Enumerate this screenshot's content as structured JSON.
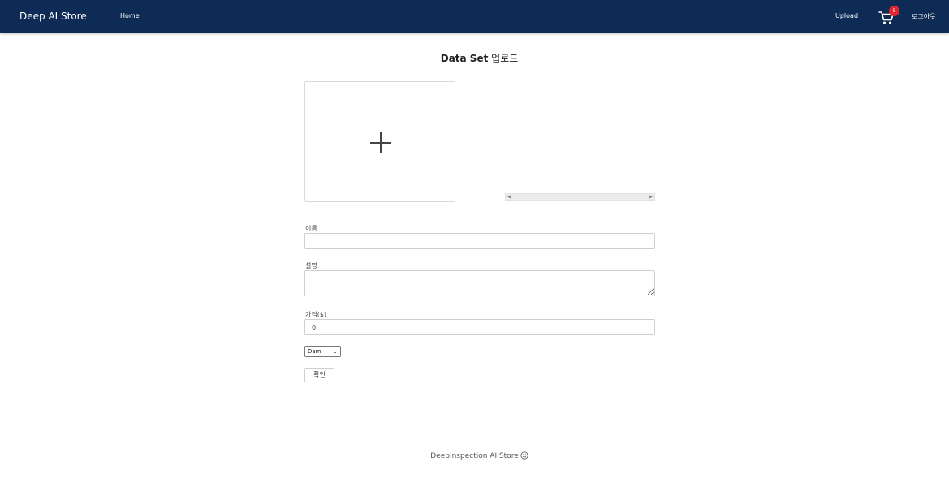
{
  "navbar": {
    "brand": "Deep AI Store",
    "home": "Home",
    "upload": "Upload",
    "cart_count": "5",
    "logout": "로그아웃"
  },
  "page": {
    "title_bold": "Data Set",
    "title_rest": " 업로드"
  },
  "form": {
    "name_label": "이름",
    "name_value": "",
    "desc_label": "설명",
    "desc_value": "",
    "price_label": "가격($)",
    "price_value": "0",
    "select_value": "Dam",
    "submit_label": "확인"
  },
  "footer": {
    "text": "DeepInspection AI Store"
  },
  "colors": {
    "navbar": "#0d2b55",
    "badge": "#e0262c"
  },
  "icons": {
    "cart": "cart-icon",
    "upload": "plus-icon",
    "footer": "smile-icon"
  }
}
